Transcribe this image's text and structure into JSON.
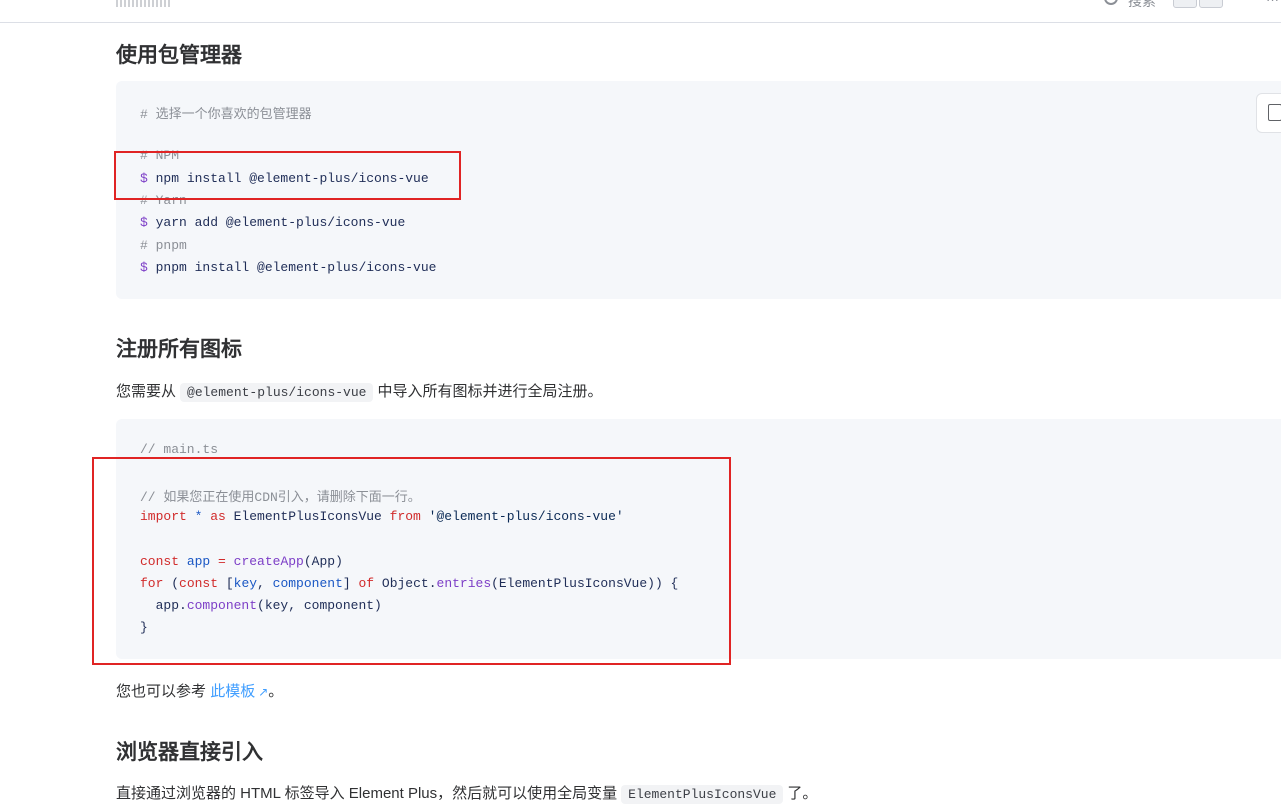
{
  "header": {
    "search_label": "搜索",
    "more_label": "···"
  },
  "section1": {
    "title": "使用包管理器",
    "code_lines": [
      {
        "t": "comment",
        "text": "# 选择一个你喜欢的包管理器"
      },
      {
        "t": "blank",
        "text": ""
      },
      {
        "t": "comment",
        "text": "# NPM"
      },
      {
        "t": "cmd",
        "prompt": "$",
        "text": " npm install @element-plus/icons-vue"
      },
      {
        "t": "comment",
        "text": "# Yarn"
      },
      {
        "t": "cmd",
        "prompt": "$",
        "text": " yarn add @element-plus/icons-vue"
      },
      {
        "t": "comment",
        "text": "# pnpm"
      },
      {
        "t": "cmd",
        "prompt": "$",
        "text": " pnpm install @element-plus/icons-vue"
      }
    ]
  },
  "section2": {
    "title": "注册所有图标",
    "desc_before": "您需要从",
    "desc_code": "@element-plus/icons-vue",
    "desc_after": "中导入所有图标并进行全局注册。",
    "code": {
      "line1": "// main.ts",
      "line2": "// 如果您正在使用CDN引入，请删除下面一行。",
      "import_kw": "import",
      "star": " * ",
      "as_kw": "as",
      "import_name": " ElementPlusIconsVue ",
      "from_kw": "from",
      "import_src": " '@element-plus/icons-vue'",
      "const_kw": "const",
      "app_var": " app",
      "eq": " = ",
      "create_fn": "createApp",
      "create_args": "(App)",
      "for_kw": "for",
      "for_open": " (",
      "const2_kw": "const",
      "bracket_open": " [",
      "key_var": "key",
      "comma": ", ",
      "component_var": "component",
      "bracket_close": "] ",
      "of_kw": "of",
      "obj": " Object.",
      "entries_fn": "entries",
      "entries_args": "(ElementPlusIconsVue)) {",
      "app_call_obj": "  app.",
      "app_call_fn": "component",
      "app_call_args": "(key, component)",
      "close": "}"
    },
    "ref_before": "您也可以参考",
    "ref_link": "此模板",
    "ref_icon": "↗",
    "ref_after": "。"
  },
  "section3": {
    "title": "浏览器直接引入",
    "desc_before": "直接通过浏览器的 HTML 标签导入 Element Plus，然后就可以使用全局变量",
    "desc_code": "ElementPlusIconsVue",
    "desc_after": "了。"
  },
  "colors": {
    "highlight_box": "#e02424",
    "link": "#409eff",
    "code_bg": "#f5f7fa"
  }
}
